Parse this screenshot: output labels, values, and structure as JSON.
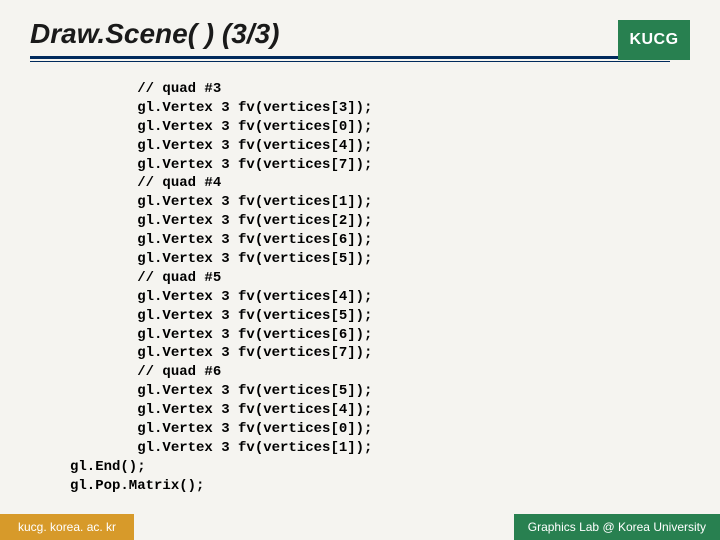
{
  "title": "Draw.Scene( ) (3/3)",
  "logo": "KUCG",
  "code": "        // quad #3\n        gl.Vertex 3 fv(vertices[3]);\n        gl.Vertex 3 fv(vertices[0]);\n        gl.Vertex 3 fv(vertices[4]);\n        gl.Vertex 3 fv(vertices[7]);\n        // quad #4\n        gl.Vertex 3 fv(vertices[1]);\n        gl.Vertex 3 fv(vertices[2]);\n        gl.Vertex 3 fv(vertices[6]);\n        gl.Vertex 3 fv(vertices[5]);\n        // quad #5\n        gl.Vertex 3 fv(vertices[4]);\n        gl.Vertex 3 fv(vertices[5]);\n        gl.Vertex 3 fv(vertices[6]);\n        gl.Vertex 3 fv(vertices[7]);\n        // quad #6\n        gl.Vertex 3 fv(vertices[5]);\n        gl.Vertex 3 fv(vertices[4]);\n        gl.Vertex 3 fv(vertices[0]);\n        gl.Vertex 3 fv(vertices[1]);\ngl.End();\ngl.Pop.Matrix();",
  "footer": {
    "left": "kucg. korea. ac. kr",
    "right": "Graphics Lab @ Korea University"
  }
}
